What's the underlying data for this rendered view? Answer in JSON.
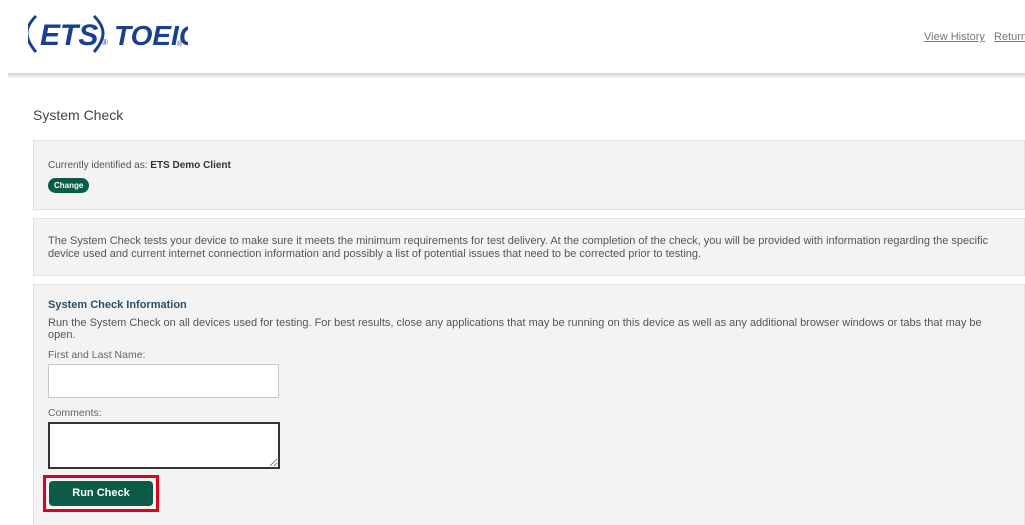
{
  "header": {
    "logo_ets": "ETS",
    "logo_product": "TOEIC",
    "logo_mark": "®",
    "links": [
      "View History",
      "Return"
    ]
  },
  "page": {
    "title": "System Check"
  },
  "identification": {
    "prefix": "Currently identified as:",
    "client": "ETS Demo Client",
    "change_label": "Change"
  },
  "description": "The System Check tests your device to make sure it meets the minimum requirements for test delivery. At the completion of the check, you will be provided with information regarding the specific device used and current internet connection information and possibly a list of potential issues that need to be corrected prior to testing.",
  "info": {
    "title": "System Check Information",
    "text": "Run the System Check on all devices used for testing. For best results, close any applications that may be running on this device as well as any additional browser windows or tabs that may be open.",
    "name_label": "First and Last Name:",
    "name_value": "",
    "comments_label": "Comments:",
    "comments_value": "",
    "run_label": "Run Check"
  },
  "colors": {
    "brand": "#0c5a48",
    "logo": "#1a3f8f",
    "highlight": "#e0001b"
  },
  "icons": {
    "resize": "resize-grip-icon"
  }
}
